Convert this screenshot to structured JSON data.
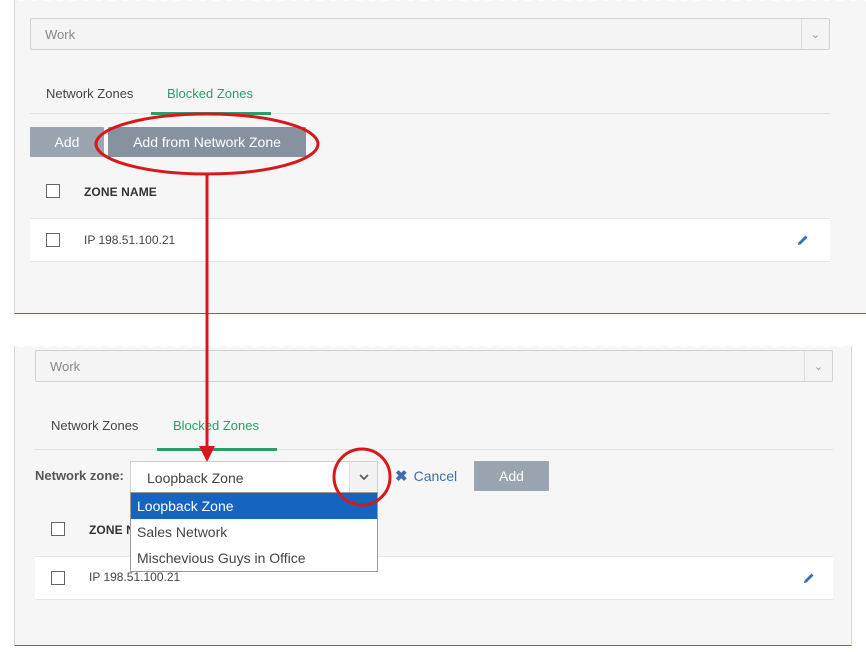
{
  "top_panel": {
    "profile_select": {
      "value": "Work"
    },
    "tabs": [
      {
        "label": "Network Zones",
        "active": false
      },
      {
        "label": "Blocked Zones",
        "active": true
      }
    ],
    "buttons": {
      "add": "Add",
      "add_from_network_zone": "Add from Network Zone"
    },
    "table": {
      "header": "ZONE NAME",
      "rows": [
        {
          "name": "IP 198.51.100.21"
        }
      ]
    }
  },
  "bottom_panel": {
    "profile_select": {
      "value": "Work"
    },
    "tabs": [
      {
        "label": "Network Zones",
        "active": false
      },
      {
        "label": "Blocked Zones",
        "active": true
      }
    ],
    "network_zone": {
      "label": "Network zone:",
      "selected": "Loopback Zone",
      "options": [
        "Loopback Zone",
        "Sales Network",
        "Mischevious Guys in Office"
      ]
    },
    "cancel_label": "Cancel",
    "add_label": "Add",
    "table": {
      "header": "ZONE N",
      "rows": [
        {
          "name": "IP 198.51.100.21"
        }
      ]
    }
  },
  "colors": {
    "accent_green": "#2a9d6b",
    "button_gray": "#9aa5b1",
    "selection_blue": "#1565c0",
    "annotation_red": "#d7191c",
    "link_blue": "#3b6fb1"
  },
  "icons": [
    "chevron-down-icon",
    "pencil-icon",
    "close-icon",
    "checkbox-icon"
  ]
}
